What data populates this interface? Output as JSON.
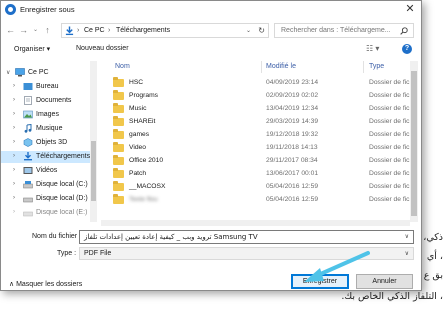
{
  "background": {
    "lines": [
      "ذكي،",
      "، أي",
      "بق ع",
      "، التلفاز الذكي الخاص بك."
    ]
  },
  "dialog": {
    "title": "Enregistrer sous",
    "close_glyph": "✕",
    "address": {
      "segments": [
        "Ce PC",
        "Téléchargements"
      ],
      "separator": "›",
      "search_placeholder": "Rechercher dans : Téléchargeme..."
    },
    "toolbar": {
      "organize_label": "Organiser ▾",
      "new_folder_label": "Nouveau dossier"
    },
    "navpane": {
      "items": [
        {
          "label": "Ce PC",
          "icon": "computer-icon"
        },
        {
          "label": "Bureau",
          "icon": "desktop-icon"
        },
        {
          "label": "Documents",
          "icon": "documents-icon"
        },
        {
          "label": "Images",
          "icon": "images-icon"
        },
        {
          "label": "Musique",
          "icon": "music-icon"
        },
        {
          "label": "Objets 3D",
          "icon": "objects3d-icon"
        },
        {
          "label": "Téléchargements",
          "icon": "downloads-icon"
        },
        {
          "label": "Vidéos",
          "icon": "videos-icon"
        },
        {
          "label": "Disque local (C:)",
          "icon": "drive-icon"
        },
        {
          "label": "Disque local (D:)",
          "icon": "drive-icon"
        },
        {
          "label": "Disque local (E:)",
          "icon": "drive-icon"
        }
      ]
    },
    "filelist": {
      "columns": {
        "name": "Nom",
        "modified": "Modifié le",
        "type": "Type"
      },
      "rows": [
        {
          "name": "HSC",
          "date": "04/09/2019 23:14",
          "type": "Dossier de fic"
        },
        {
          "name": "Programs",
          "date": "02/09/2019 02:02",
          "type": "Dossier de fic"
        },
        {
          "name": "Music",
          "date": "13/04/2019 12:34",
          "type": "Dossier de fic"
        },
        {
          "name": "SHAREit",
          "date": "29/03/2019 14:39",
          "type": "Dossier de fic"
        },
        {
          "name": "games",
          "date": "19/12/2018 19:32",
          "type": "Dossier de fic"
        },
        {
          "name": "Video",
          "date": "19/11/2018 14:13",
          "type": "Dossier de fic"
        },
        {
          "name": "Office 2010",
          "date": "29/11/2017 08:34",
          "type": "Dossier de fic"
        },
        {
          "name": "Patch",
          "date": "13/06/2017 00:01",
          "type": "Dossier de fic"
        },
        {
          "name": "__MACOSX",
          "date": "05/04/2016 12:59",
          "type": "Dossier de fic"
        },
        {
          "name": "Texte flou",
          "date": "05/04/2016 12:59",
          "type": "Dossier de fic",
          "blurred": true
        }
      ]
    },
    "filename_label": "Nom du fichier :",
    "filename_value": "ترويد وبب _ كيفية إعادة تعيين إعدادات تلفاز Samsung TV",
    "type_label": "Type :",
    "type_value": "PDF File",
    "hide_folders_label": "Masquer les dossiers",
    "save_button": "Enregistrer",
    "cancel_button": "Annuler"
  }
}
